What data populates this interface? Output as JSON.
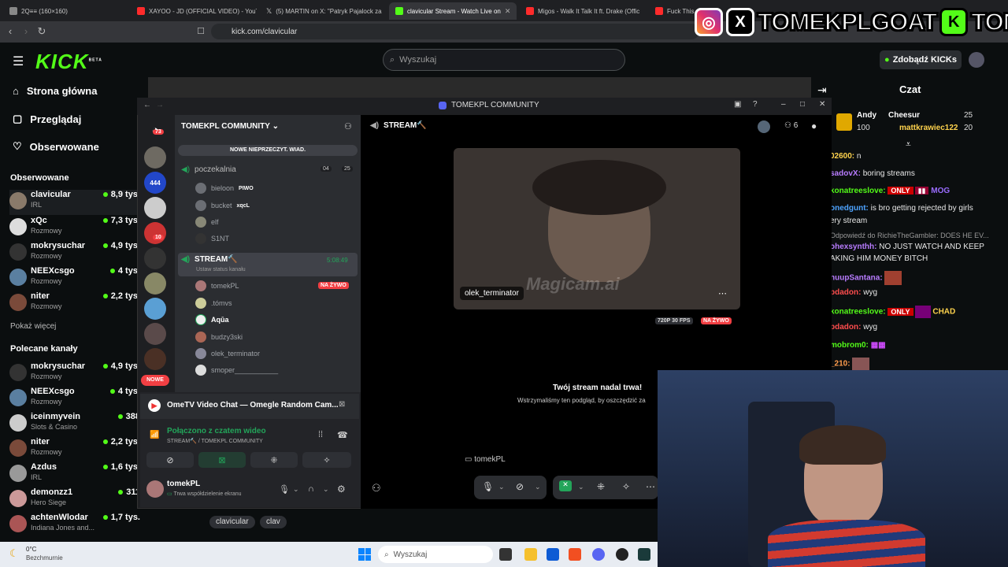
{
  "browser": {
    "tabs": [
      {
        "label": "2Q≡≡ (160×160)",
        "color": "#888"
      },
      {
        "label": "XAYOO - JD (OFFICIAL VIDEO) - YouT",
        "color": "#ff2b2b"
      },
      {
        "label": "(5) MARTIN on X: \"Patryk Pajalock za",
        "color": "#fff"
      },
      {
        "label": "clavicular Stream - Watch Live on",
        "color": "#53fc18"
      },
      {
        "label": "Migos - Walk It Talk It ft. Drake (Offic",
        "color": "#ff2b2b"
      },
      {
        "label": "Fuck This",
        "color": "#ff2b2b"
      }
    ],
    "url": "kick.com/clavicular"
  },
  "overlay": {
    "brand1": "TOMEKPLGOAT",
    "brand2": "TOMEKPL",
    "k": "K",
    "x": "X"
  },
  "kick": {
    "logo": "KICK",
    "logo_sup": "BETA",
    "search_placeholder": "Wyszukaj",
    "kicks_button": "Zdobądź KICKs",
    "nav": [
      "Strona główna",
      "Przeglądaj",
      "Obserwowane"
    ],
    "followed_title": "Obserwowane",
    "followed": [
      {
        "name": "clavicular",
        "cat": "IRL",
        "viewers": "8,9 tys."
      },
      {
        "name": "xQc",
        "cat": "Rozmowy",
        "viewers": "7,3 tys."
      },
      {
        "name": "mokrysuchar",
        "cat": "Rozmowy",
        "viewers": "4,9 tys."
      },
      {
        "name": "NEEXcsgo",
        "cat": "Rozmowy",
        "viewers": "4 tys."
      },
      {
        "name": "niter",
        "cat": "Rozmowy",
        "viewers": "2,2 tys."
      }
    ],
    "show_more": "Pokaż więcej",
    "recommended_title": "Polecane kanały",
    "recommended": [
      {
        "name": "mokrysuchar",
        "cat": "Rozmowy",
        "viewers": "4,9 tys."
      },
      {
        "name": "NEEXcsgo",
        "cat": "Rozmowy",
        "viewers": "4 tys."
      },
      {
        "name": "iceinmyvein",
        "cat": "Slots & Casino",
        "viewers": "388"
      },
      {
        "name": "niter",
        "cat": "Rozmowy",
        "viewers": "2,2 tys."
      },
      {
        "name": "Azdus",
        "cat": "IRL",
        "viewers": "1,6 tys."
      },
      {
        "name": "demonzz1",
        "cat": "Hero Siege",
        "viewers": "311"
      },
      {
        "name": "achtenWlodar",
        "cat": "Indiana Jones and...",
        "viewers": "1,7 tys."
      }
    ],
    "tags": [
      "clavicular",
      "clav"
    ],
    "chat_title": "Czat"
  },
  "chat": {
    "top": [
      {
        "user": "Andy",
        "val": "100"
      },
      {
        "user": "Cheesur",
        "val": "25"
      },
      {
        "user": "mattkrawiec122",
        "val": "20"
      }
    ],
    "messages": [
      {
        "user": "02600:",
        "text": "n",
        "color": "#ffd34d"
      },
      {
        "user": "sadovX:",
        "text": "boring streams",
        "color": "#b87cff"
      },
      {
        "user": "konatreeslove:",
        "text": "MOG",
        "color": "#53fc18"
      },
      {
        "user": "onedgunt:",
        "text": "is bro getting rejected by girls",
        "color": "#4da3ff"
      },
      {
        "user": "",
        "text": "ery stream",
        "color": "#fff"
      },
      {
        "user": "",
        "text": "Odpowiedź do RichieTheGambler: DOES HE EV...",
        "color": "#999"
      },
      {
        "user": "ohexsynthh:",
        "text": "NO JUST WATCH AND KEEP",
        "color": "#b87cff"
      },
      {
        "user": "",
        "text": "AKING HIM MONEY BITCH",
        "color": "#fff"
      },
      {
        "user": "nuupSantana:",
        "text": "",
        "color": "#b87cff"
      },
      {
        "user": "pdadon:",
        "text": "wyg",
        "color": "#ff4d4d"
      },
      {
        "user": "konatreeslove:",
        "text": "CHAD",
        "color": "#53fc18"
      },
      {
        "user": "pdadon:",
        "text": "wyg",
        "color": "#ff4d4d"
      },
      {
        "user": "mobrom0:",
        "text": "",
        "color": "#53fc18"
      },
      {
        "user": "_210:",
        "text": "",
        "color": "#ff9d4d"
      }
    ]
  },
  "discord": {
    "window_title": "TOMEKPL COMMUNITY",
    "server_name": "TOMEKPL COMMUNITY",
    "unread_banner": "NOWE NIEPRZECZYT. WIAD.",
    "badge_73": "73",
    "badge_10": "10",
    "new_label": "NOWE",
    "waiting_channel": "poczekalnia",
    "waiting_count_a": "04",
    "waiting_count_b": "25",
    "waiting_users": [
      {
        "name": "bieloon",
        "tag": "PIWO"
      },
      {
        "name": "bucket",
        "tag": "xqcL"
      },
      {
        "name": "elf",
        "tag": ""
      },
      {
        "name": "S1NT",
        "tag": ""
      }
    ],
    "stream_channel": "STREAM🔨",
    "stream_time": "5:08:49",
    "channel_status": "Ustaw status kanału",
    "stream_users": [
      {
        "name": "tomekPL",
        "bold": false
      },
      {
        "name": ".tómvs",
        "bold": false
      },
      {
        "name": "Aqūa",
        "bold": true
      },
      {
        "name": "budzy3ski",
        "bold": false
      },
      {
        "name": "olek_terminator",
        "bold": false
      },
      {
        "name": "smoper___________",
        "bold": false
      }
    ],
    "live_label": "NA ŻYWO",
    "stage_title": "STREAM🔨",
    "people_count": "6",
    "cam_name": "olek_terminator",
    "watermark": "Magicam.ai",
    "quality": "720P 30 FPS",
    "paused_title": "Twój stream nadal trwa!",
    "paused_sub": "Wstrzymaliśmy ten podgląd, by oszczędzić za",
    "streamer_label": "tomekPL",
    "activity_title": "OmeTV Video Chat — Omegle Random Cam...",
    "connected": "Połączono z czatem wideo",
    "connected_sub": "STREAM🔨 / TOMEKPL COMMUNITY",
    "user_name": "tomekPL",
    "user_status": "Trwa współdzielenie ekranu"
  },
  "taskbar": {
    "temp": "0°C",
    "weather": "Bezchmurnie",
    "search": "Wyszukaj"
  }
}
